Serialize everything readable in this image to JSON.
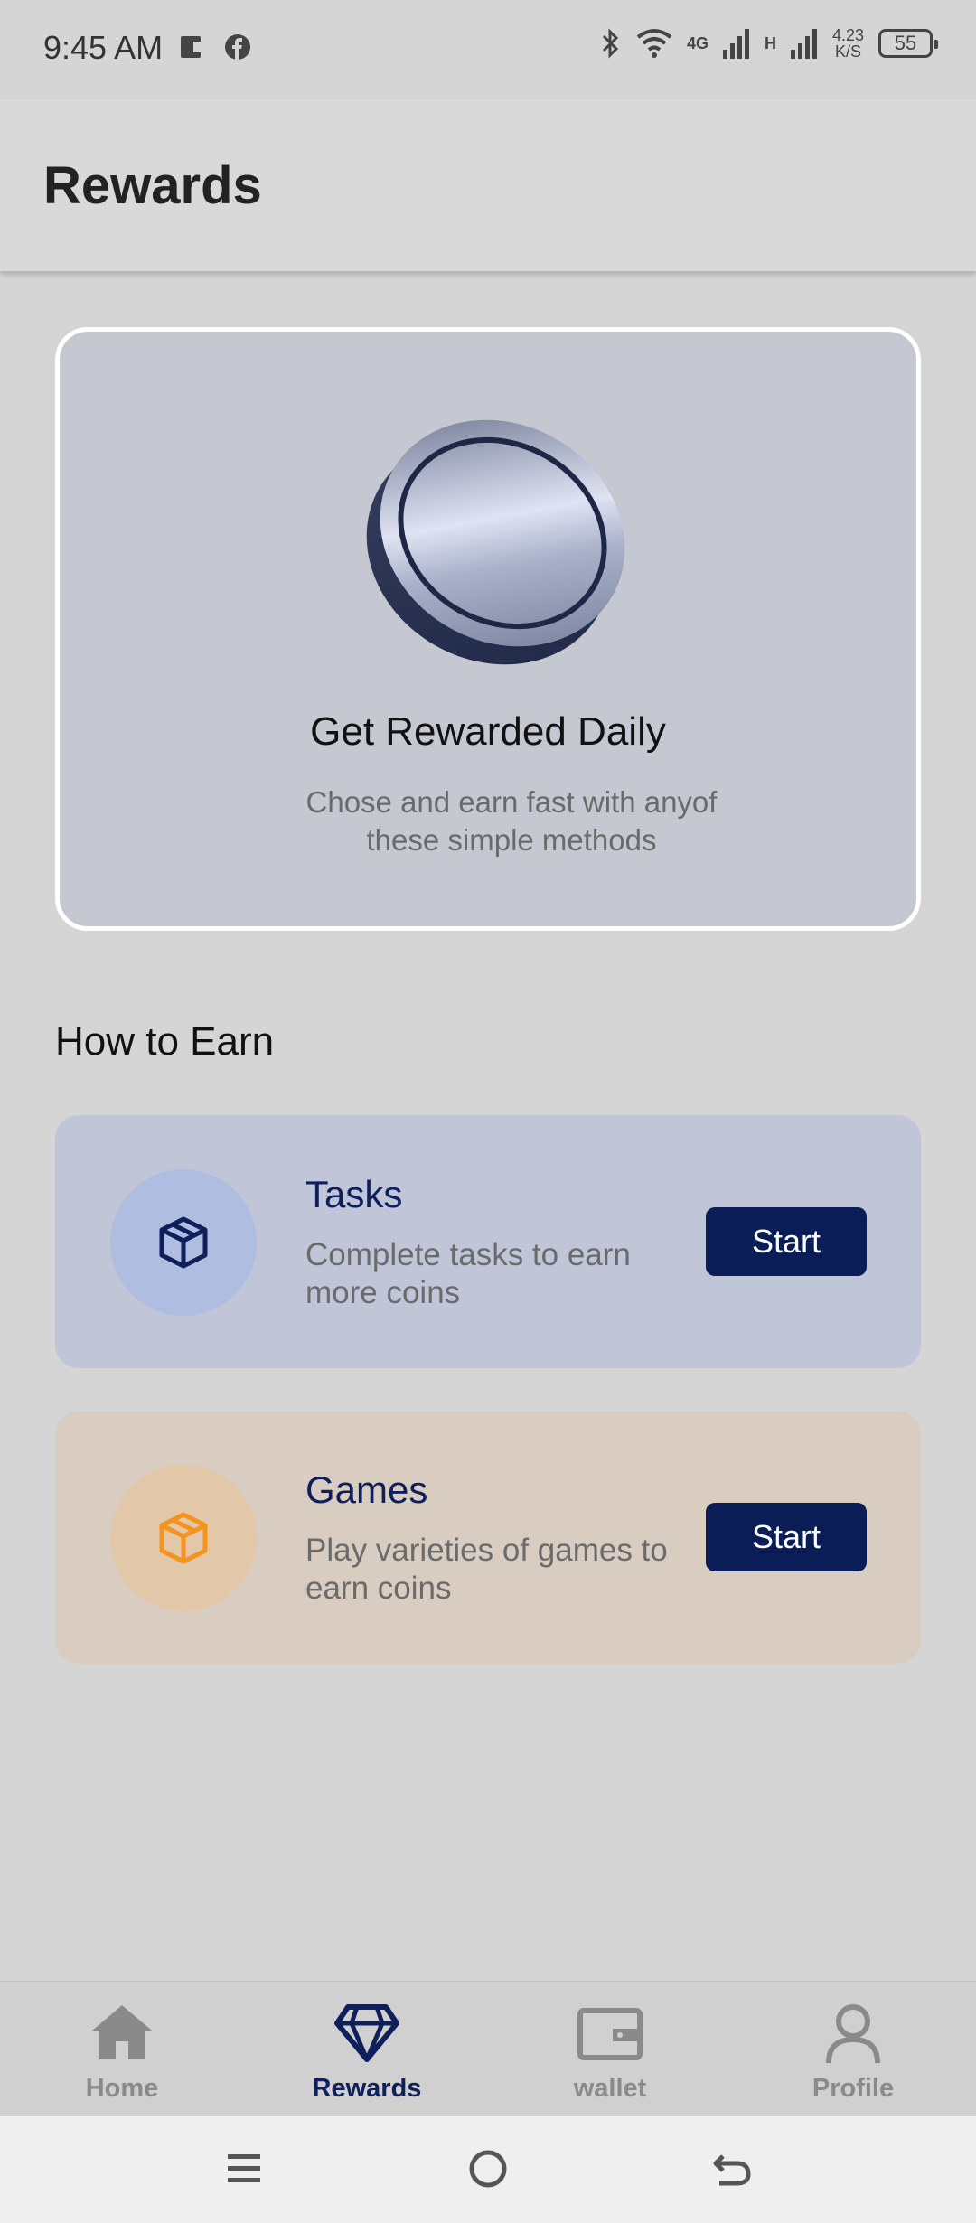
{
  "status_bar": {
    "time": "9:45 AM",
    "network_4g": "4G",
    "network_h": "H",
    "speed_value": "4.23",
    "speed_unit": "K/S",
    "battery": "55"
  },
  "header": {
    "title": "Rewards"
  },
  "hero": {
    "title": "Get Rewarded Daily",
    "subtitle": "Chose and earn fast with anyof these simple methods"
  },
  "section": {
    "title": "How to Earn"
  },
  "earn_methods": [
    {
      "title": "Tasks",
      "description": "Complete tasks to earn more coins",
      "button": "Start",
      "icon": "box-icon",
      "color": "#0f1f5c"
    },
    {
      "title": "Games",
      "description": "Play varieties of games to earn coins",
      "button": "Start",
      "icon": "box-icon",
      "color": "#f5931e"
    }
  ],
  "bottom_nav": {
    "items": [
      {
        "label": "Home",
        "icon": "home-icon"
      },
      {
        "label": "Rewards",
        "icon": "diamond-icon",
        "active": true
      },
      {
        "label": "wallet",
        "icon": "wallet-icon"
      },
      {
        "label": "Profile",
        "icon": "profile-icon"
      }
    ]
  },
  "colors": {
    "accent": "#0b1d57",
    "orange": "#f5931e",
    "inactive": "#8a8a8a"
  }
}
